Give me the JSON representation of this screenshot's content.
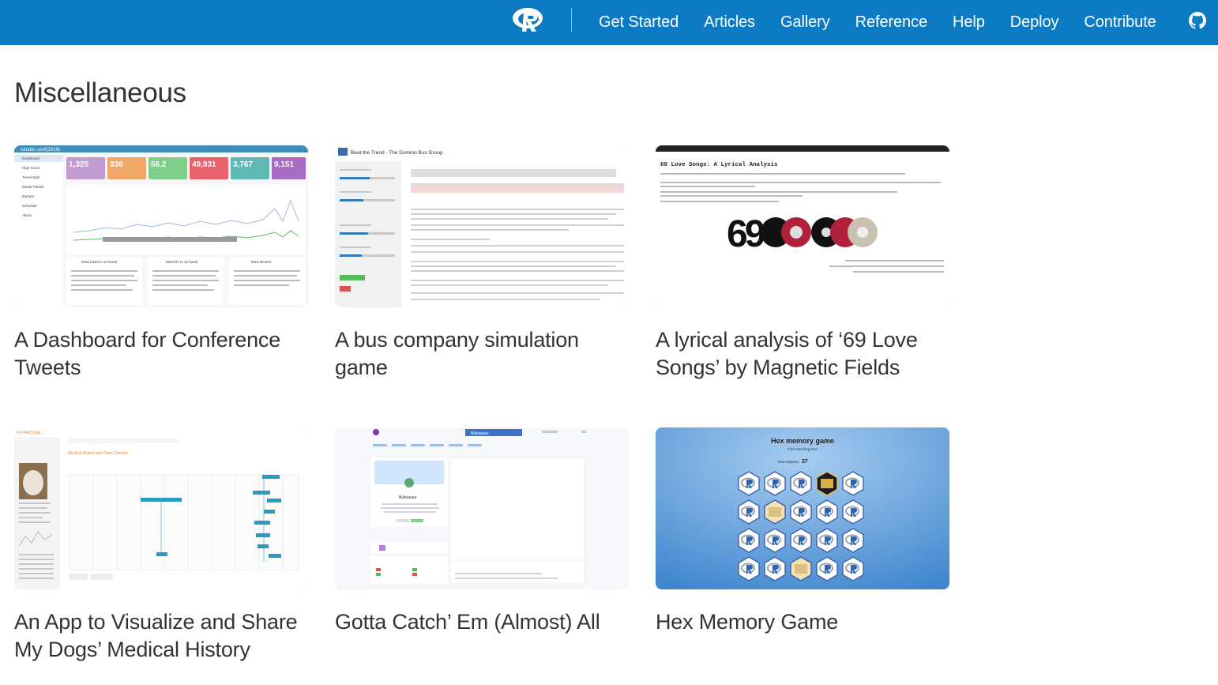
{
  "nav": {
    "links": [
      "Get Started",
      "Articles",
      "Gallery",
      "Reference",
      "Help",
      "Deploy",
      "Contribute"
    ]
  },
  "page": {
    "title": "Miscellaneous"
  },
  "cards": [
    {
      "title": "A Dashboard for Conference Tweets",
      "thumb": {
        "brand": "rstudio::conf(2019)",
        "menu": [
          "Dashboard",
          "High Score",
          "Tweet Wall",
          "Media Tweets",
          "Explore",
          "Schedule",
          "About"
        ],
        "stats": [
          "1,325",
          "336",
          "56.2",
          "49,931",
          "3,767",
          "9,151"
        ],
        "sections": [
          "Most Liked in 12 hours",
          "Most RT in 12 hours",
          "Most Recent"
        ]
      }
    },
    {
      "title": "A bus company simulation game",
      "thumb": {
        "heading": "Beat the Trend - The Domino Bus Group"
      }
    },
    {
      "title": "A lyrical analysis of ‘69 Love Songs’ by Magnetic Fields",
      "thumb": {
        "heading": "69 Love Songs: A Lyrical Analysis",
        "big": "69"
      }
    },
    {
      "title": "An App to Visualize and Share My Dogs’ Medical History",
      "thumb": {
        "heading": "Pet Records",
        "subheading": "Medical History and Tests Timeline"
      }
    },
    {
      "title": "Gotta Catch’ Em (Almost) All",
      "thumb": {
        "select_value": "Bulbasaur",
        "name": "Bulbasaur"
      }
    },
    {
      "title": "Hex Memory Game",
      "thumb": {
        "heading": "Hex memory game",
        "subheading": "Find matching hex!",
        "time_label": "Time elapsed:",
        "time_value": "37"
      }
    }
  ],
  "colors": {
    "navbar": "#0d7ac4",
    "hex_bg": "#5b9fd6"
  }
}
